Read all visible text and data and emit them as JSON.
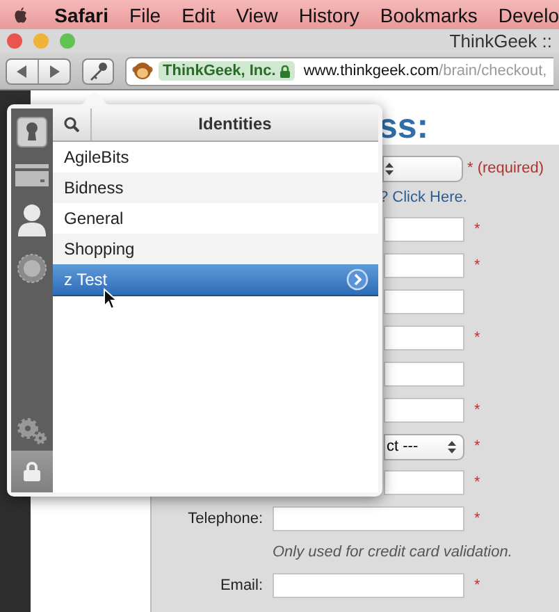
{
  "menu_bar": {
    "items": [
      {
        "label": "Safari",
        "kind": "app"
      },
      {
        "label": "File",
        "kind": "menu"
      },
      {
        "label": "Edit",
        "kind": "menu"
      },
      {
        "label": "View",
        "kind": "menu"
      },
      {
        "label": "History",
        "kind": "menu"
      },
      {
        "label": "Bookmarks",
        "kind": "menu"
      },
      {
        "label": "Develo",
        "kind": "menu"
      }
    ]
  },
  "window": {
    "title": "ThinkGeek ::"
  },
  "address_bar": {
    "site_identity": "ThinkGeek, Inc.",
    "host": "www.thinkgeek.com",
    "path": "/brain/checkout,"
  },
  "popup": {
    "category": "Identities",
    "items": [
      {
        "label": "AgileBits",
        "selected": false
      },
      {
        "label": "Bidness",
        "selected": false
      },
      {
        "label": "General",
        "selected": false
      },
      {
        "label": "Shopping",
        "selected": false
      },
      {
        "label": "z Test",
        "selected": true
      }
    ]
  },
  "form": {
    "heading": "ss:",
    "required_note": "* (required)",
    "link": "? Click Here.",
    "rows": [
      {
        "kind": "field",
        "mark": "*"
      },
      {
        "kind": "field",
        "mark": "*"
      },
      {
        "kind": "field"
      },
      {
        "kind": "field",
        "mark": "*"
      },
      {
        "kind": "field"
      },
      {
        "kind": "field",
        "mark": "*"
      },
      {
        "kind": "select",
        "value": "ct ---",
        "mark": "*"
      },
      {
        "kind": "field",
        "mark": "*"
      },
      {
        "kind": "field",
        "label": "Telephone:",
        "mark": "*"
      },
      {
        "kind": "note",
        "text": "Only used for credit card validation."
      },
      {
        "kind": "field",
        "label": "Email:",
        "mark": "*"
      }
    ]
  }
}
